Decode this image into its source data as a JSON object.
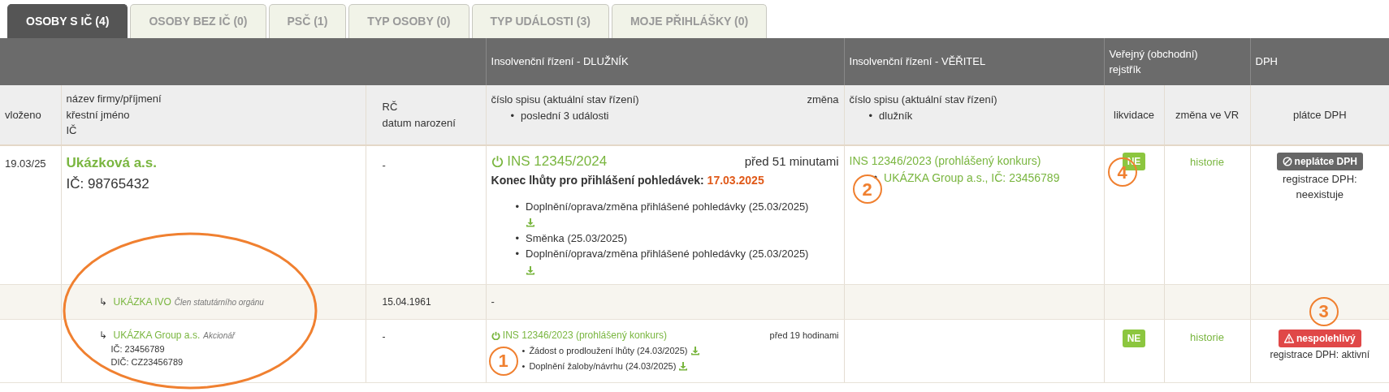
{
  "tabs": [
    {
      "label": "OSOBY S IČ (4)",
      "selected": true
    },
    {
      "label": "OSOBY BEZ IČ (0)",
      "selected": false
    },
    {
      "label": "PSČ (1)",
      "selected": false
    },
    {
      "label": "TYP OSOBY (0)",
      "selected": false
    },
    {
      "label": "TYP UDÁLOSTI (3)",
      "selected": false
    },
    {
      "label": "MOJE PŘIHLÁŠKY (0)",
      "selected": false
    }
  ],
  "table": {
    "group_headers": [
      "Insolvenční řízení - DLUŽNÍK",
      "Insolvenční řízení - VĚŘITEL",
      "Veřejný (obchodní) rejstřík",
      "DPH"
    ],
    "columns": {
      "added": "vloženo",
      "name": [
        "název firmy/příjmení",
        "křestní jméno",
        "IČ"
      ],
      "rc": [
        "RČ",
        "datum narození"
      ],
      "debtor": {
        "case": "číslo spisu (aktuální stav řízení)",
        "change": "změna",
        "bullet": {
          "marker": "•",
          "text": "poslední 3 události"
        }
      },
      "creditor": {
        "case": "číslo spisu (aktuální stav řízení)",
        "bullet": {
          "marker": "•",
          "text": "dlužník"
        }
      },
      "liquidation": "likvidace",
      "vr": "změna ve VR",
      "vat": "plátce DPH"
    },
    "rows": [
      {
        "kind": "company",
        "added": "19.03/25",
        "name": "Ukázková a.s.",
        "ic": "IČ: 98765432",
        "rc": "-",
        "debtor": {
          "case": "INS 12345/2024",
          "change": "před 51 minutami",
          "deadline_label": "Konec lhůty pro přihlášení pohledávek:",
          "deadline": "17.03.2025",
          "events": [
            {
              "marker": "•",
              "text": "Doplnění/oprava/změna přihlášené pohledávky (25.03/2025)",
              "download": true
            },
            {
              "marker": "•",
              "text": "Směnka (25.03/2025)",
              "download": false
            },
            {
              "marker": "•",
              "text": "Doplnění/oprava/změna přihlášené pohledávky (25.03/2025)",
              "download": true
            }
          ]
        },
        "creditor": {
          "case": "INS 12346/2023 (prohlášený konkurs)",
          "debtors": [
            {
              "marker": "•",
              "text": "UKÁZKA Group a.s., IČ: 23456789"
            }
          ],
          "callout": "2"
        },
        "liquidation": {
          "label": "NE",
          "callout": "4"
        },
        "vr": "historie",
        "vat": {
          "badge": {
            "kind": "nonpayer",
            "label": "neplátce DPH"
          },
          "registration": "registrace DPH: neexistuje"
        }
      },
      {
        "kind": "person",
        "marker": "↳",
        "name": "UKÁZKA IVO",
        "role": "Člen statutárního orgánu",
        "rc": "15.04.1961",
        "debtor_text": "-"
      },
      {
        "kind": "related",
        "marker": "↳",
        "name": "UKÁZKA Group a.s.",
        "role": "Akcionář",
        "ic": "IČ: 23456789",
        "dic": "DIČ: CZ23456789",
        "rc": "-",
        "debtor": {
          "case": "INS 12346/2023 (prohlášený konkurs)",
          "change": "před 19 hodinami",
          "callout": "1",
          "events": [
            {
              "marker": "•",
              "text": "Žádost o prodloužení lhůty (24.03/2025)",
              "download": true
            },
            {
              "marker": "•",
              "text": "Doplnění žaloby/návrhu (24.03/2025)",
              "download": true
            }
          ]
        },
        "liquidation": {
          "label": "NE"
        },
        "vr": "historie",
        "vat": {
          "badge": {
            "kind": "unreliable",
            "label": "nespolehlivý"
          },
          "registration": "registrace DPH: aktivní",
          "callout": "3"
        }
      }
    ]
  }
}
